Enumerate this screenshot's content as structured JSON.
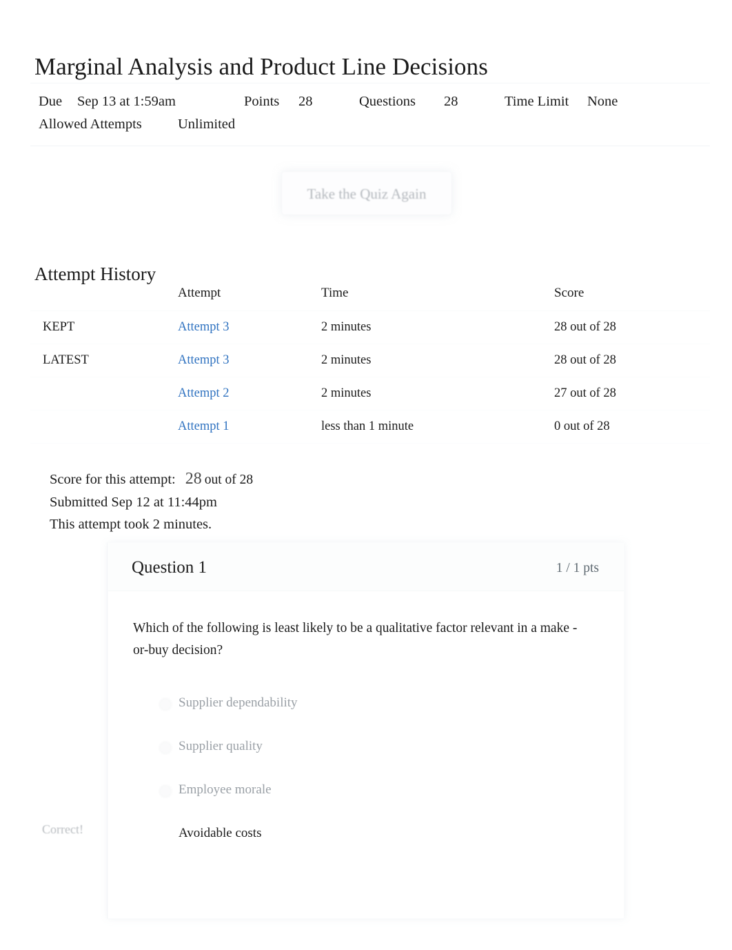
{
  "quiz": {
    "title": "Marginal Analysis and Product Line Decisions",
    "meta": {
      "due_label": "Due",
      "due_value": "Sep 13 at 1:59am",
      "points_label": "Points",
      "points_value": "28",
      "questions_label": "Questions",
      "questions_value": "28",
      "time_limit_label": "Time Limit",
      "time_limit_value": "None",
      "allowed_attempts_label": "Allowed Attempts",
      "allowed_attempts_value": "Unlimited"
    },
    "retake_button_label": "Take the Quiz Again"
  },
  "attempt_history": {
    "heading": "Attempt History",
    "columns": {
      "flag": "",
      "attempt": "Attempt",
      "time": "Time",
      "score": "Score"
    },
    "rows": [
      {
        "flag": "KEPT",
        "attempt": "Attempt 3",
        "time": "2 minutes",
        "score": "28 out of 28"
      },
      {
        "flag": "LATEST",
        "attempt": "Attempt 3",
        "time": "2 minutes",
        "score": "28 out of 28"
      },
      {
        "flag": "",
        "attempt": "Attempt 2",
        "time": "2 minutes",
        "score": "27 out of 28"
      },
      {
        "flag": "",
        "attempt": "Attempt 1",
        "time": "less than 1 minute",
        "score": "0 out of 28"
      }
    ]
  },
  "attempt_summary": {
    "score_label": "Score for this attempt:",
    "score_value": "28",
    "score_outof": "out of 28",
    "submitted": "Submitted Sep 12 at 11:44pm",
    "duration": "This attempt took 2 minutes."
  },
  "question": {
    "title": "Question 1",
    "points": "1 / 1 pts",
    "text": "Which of the following is least likely to be a qualitative factor relevant in a make -or-buy decision?",
    "correct_flag": "Correct!",
    "answers": [
      {
        "label": "Supplier dependability",
        "selected": false
      },
      {
        "label": "Supplier quality",
        "selected": false
      },
      {
        "label": "Employee morale",
        "selected": false
      },
      {
        "label": "Avoidable costs",
        "selected": true
      }
    ]
  },
  "colors": {
    "link": "#2f72c0",
    "text": "#1a1a1a",
    "muted": "#9aa0a6",
    "faded": "#b9bdc1"
  }
}
